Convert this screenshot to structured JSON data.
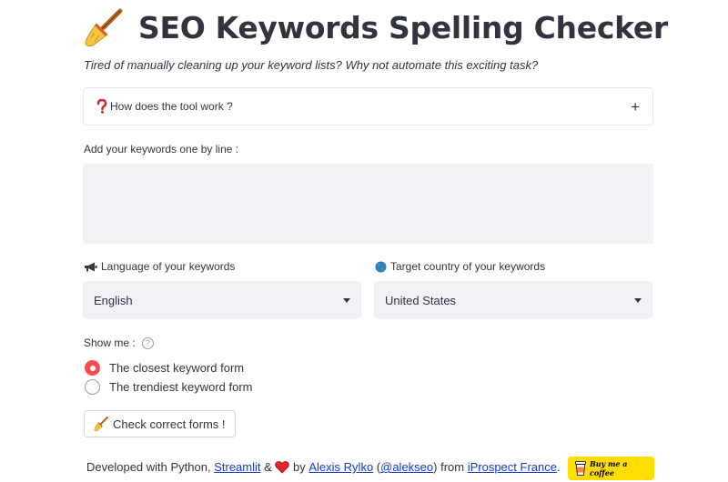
{
  "header": {
    "title": "SEO Keywords Spelling Checker",
    "title_icon": "broom-icon",
    "subtitle": "Tired of manually cleaning up your keyword lists? Why not automate this exciting task?"
  },
  "expander": {
    "icon": "question-mark-icon",
    "label": "How does the tool work ?",
    "toggle": "+"
  },
  "keywords_input": {
    "label": "Add your keywords one by line :",
    "value": ""
  },
  "language": {
    "icon": "megaphone-icon",
    "label": "Language of your keywords",
    "selected": "English"
  },
  "country": {
    "icon": "globe-icon",
    "label": "Target country of your keywords",
    "selected": "United States"
  },
  "show_me": {
    "label": "Show me :",
    "help": "?",
    "options": [
      {
        "label": "The closest keyword form",
        "checked": true
      },
      {
        "label": "The trendiest keyword form",
        "checked": false
      }
    ]
  },
  "check_button": {
    "icon": "broom-icon",
    "label": "Check correct forms !"
  },
  "footer": {
    "prefix": "Developed with Python, ",
    "streamlit": "Streamlit",
    "and": " & ",
    "heart_icon": "heart-icon",
    "by": " by ",
    "author": "Alexis Rylko",
    "paren_open": " (",
    "handle": "@alekseo",
    "from": ") from ",
    "company": "iProspect France",
    "suffix": "."
  },
  "coffee_button": {
    "label": "Buy me a coffee",
    "icon": "coffee-cup-icon"
  },
  "colors": {
    "accent": "#ff4b4b",
    "text": "#31333f",
    "input_bg": "#f0f2f6",
    "link": "#0f3cc9",
    "coffee": "#ffdd00"
  }
}
